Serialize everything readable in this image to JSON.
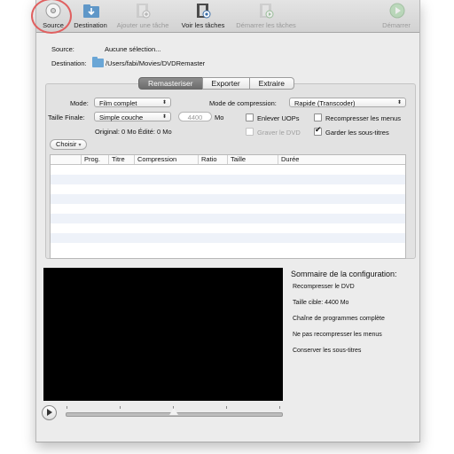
{
  "toolbar": {
    "source": "Source",
    "destination": "Destination",
    "add_task": "Ajouter une tâche",
    "view_tasks": "Voir les tâches",
    "start_tasks": "Démarrer les tâches",
    "start": "Démarrer"
  },
  "info": {
    "source_label": "Source:",
    "source_value": "Aucune sélection...",
    "destination_label": "Destination:",
    "destination_value": "/Users/fabi/Movies/DVDRemaster"
  },
  "tabs": [
    "Remasteriser",
    "Exporter",
    "Extraire"
  ],
  "selected_tab": "Remasteriser",
  "form": {
    "mode_label": "Mode:",
    "mode_value": "Film complet",
    "compression_mode_label": "Mode de compression:",
    "compression_mode_value": "Rapide (Transcoder)",
    "final_size_label": "Taille Finale:",
    "final_size_value": "Simple couche",
    "size_field_placeholder": "4400",
    "size_unit": "Mo",
    "remove_uops": "Enlever UOPs",
    "recompress_menus": "Recompresser les menus",
    "original_edited": "Original: 0 Mo Édité: 0 Mo",
    "burn_dvd": "Graver le DVD",
    "keep_subtitles": "Garder les sous-titres",
    "choose_button": "Choisir"
  },
  "table": {
    "columns": [
      "Prog.",
      "Titre",
      "Compression",
      "Ratio",
      "Taille",
      "Durée"
    ]
  },
  "summary": {
    "title": "Sommaire de la configuration:",
    "lines": [
      "Recompresser le DVD",
      "Taille cible: 4400 Mo",
      "Chaîne de programmes complète",
      "Ne pas recompresser les menus",
      "Conserver les sous-titres"
    ]
  },
  "colors": {
    "highlight_ring": "#e06060",
    "selected_tab_bg": "#777777",
    "folder_icon": "#6aa6d6",
    "table_alt_row": "#eef2f9"
  }
}
